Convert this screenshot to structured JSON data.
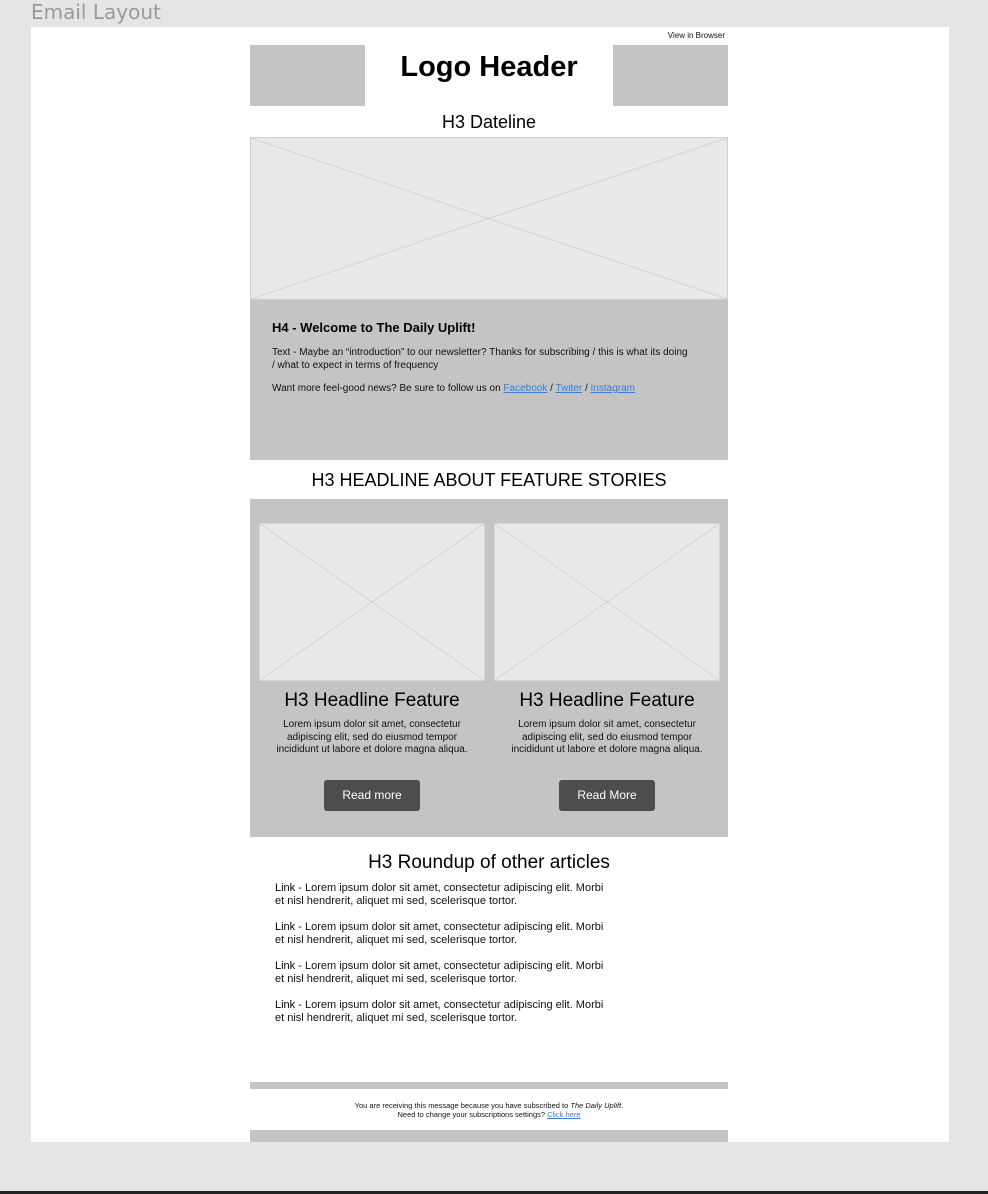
{
  "frame": {
    "label": "Email Layout"
  },
  "email": {
    "view_in_browser": "View in Browser",
    "logo": "Logo Header",
    "dateline": "H3 Dateline",
    "intro": {
      "heading": "H4 - Welcome to The Daily Uplift!",
      "text": "Text - Maybe an “introduction” to our newsletter? Thanks for subscribing / this is what its doing / what to expect in terms of frequency",
      "follow_prefix": "Want more feel-good news? Be sure to follow us on ",
      "links": [
        "Facebook",
        "Twiter",
        "Instagram"
      ],
      "separator": " / "
    },
    "features_title": "H3 HEADLINE ABOUT FEATURE STORIES",
    "features": [
      {
        "title": "H3 Headline Feature",
        "text": "Lorem ipsum dolor sit amet, consectetur adipiscing elit, sed do eiusmod tempor incididunt ut labore et dolore magna aliqua.",
        "button": "Read more"
      },
      {
        "title": "H3 Headline Feature",
        "text": "Lorem ipsum dolor sit amet, consectetur adipiscing elit, sed do eiusmod tempor incididunt ut labore et dolore magna aliqua.",
        "button": "Read More"
      }
    ],
    "roundup": {
      "title": "H3 Roundup of other articles",
      "items": [
        {
          "link": "Link",
          "text": " - Lorem ipsum dolor sit amet, consectetur adipiscing elit. Morbi et nisl hendrerit, aliquet mi sed, scelerisque tortor."
        },
        {
          "link": "Link",
          "text": " - Lorem ipsum dolor sit amet, consectetur adipiscing elit. Morbi et nisl hendrerit, aliquet mi sed, scelerisque tortor."
        },
        {
          "link": "Link",
          "text": " - Lorem ipsum dolor sit amet, consectetur adipiscing elit. Morbi et nisl hendrerit, aliquet mi sed, scelerisque tortor."
        },
        {
          "link": "Link",
          "text": " - Lorem ipsum dolor sit amet, consectetur adipiscing elit. Morbi et nisl hendrerit, aliquet mi sed, scelerisque tortor."
        }
      ]
    },
    "footer": {
      "line1_prefix": "You are receiving this message because you have subscribed to ",
      "line1_name": "The Daily Uplift",
      "line1_suffix": ".",
      "line2_prefix": "Need to change your subscriptions settings? ",
      "line2_link": "Click here"
    }
  },
  "colors": {
    "placeholder_block": "#c4c4c4",
    "image_bg": "#e8e8e8",
    "button_bg": "#4d4d4d",
    "link": "#3b7bd9"
  }
}
